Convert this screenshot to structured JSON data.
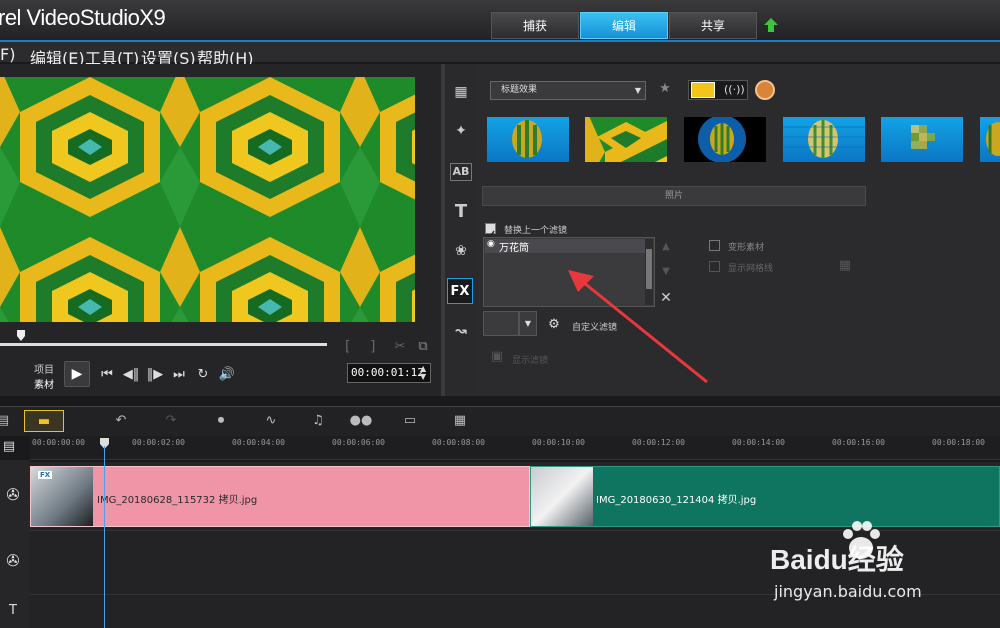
{
  "app": {
    "title": "rel VideoStudioX9"
  },
  "tabs": [
    {
      "label": "捕获"
    },
    {
      "label": "编辑"
    },
    {
      "label": "共享"
    }
  ],
  "menu": {
    "items": [
      "F)",
      "编辑(E)",
      "工具(T)",
      "设置(S)",
      "帮助(H)"
    ]
  },
  "player": {
    "mode_project": "项目",
    "mode_clip": "素材",
    "timecode": "00:00:01:12",
    "mark_in": "[",
    "mark_out": "]"
  },
  "library": {
    "category": "标题效果",
    "thumbnails": [
      "balloon",
      "kaleidoscope",
      "balloon-spotlight",
      "balloon-stripes",
      "balloon-pixel",
      "balloon-partial"
    ]
  },
  "options": {
    "header": "照片",
    "replace_last_filter": "替换上一个滤镜",
    "filter_name": "万花筒",
    "deform_clip": "变形素材",
    "show_grid": "显示网格线",
    "custom_filter": "自定义滤镜",
    "show_filter": "显示滤镜"
  },
  "timeline": {
    "ruler": [
      "00:00:00:00",
      "00:00:02:00",
      "00:00:04:00",
      "00:00:06:00",
      "00:00:08:00",
      "00:00:10:00",
      "00:00:12:00",
      "00:00:14:00",
      "00:00:16:00",
      "00:00:18:00"
    ],
    "clips": [
      {
        "name": "IMG_20180628_115732 拷贝.jpg",
        "color": "#ef95a7",
        "fx": "FX"
      },
      {
        "name": "IMG_20180630_121404 拷贝.jpg",
        "color": "#0f7560"
      }
    ]
  },
  "watermark": {
    "brand": "Baidu经验",
    "url": "jingyan.baidu.com"
  },
  "colors": {
    "accent": "#1e9ee0",
    "arrow": "#e8383d"
  }
}
